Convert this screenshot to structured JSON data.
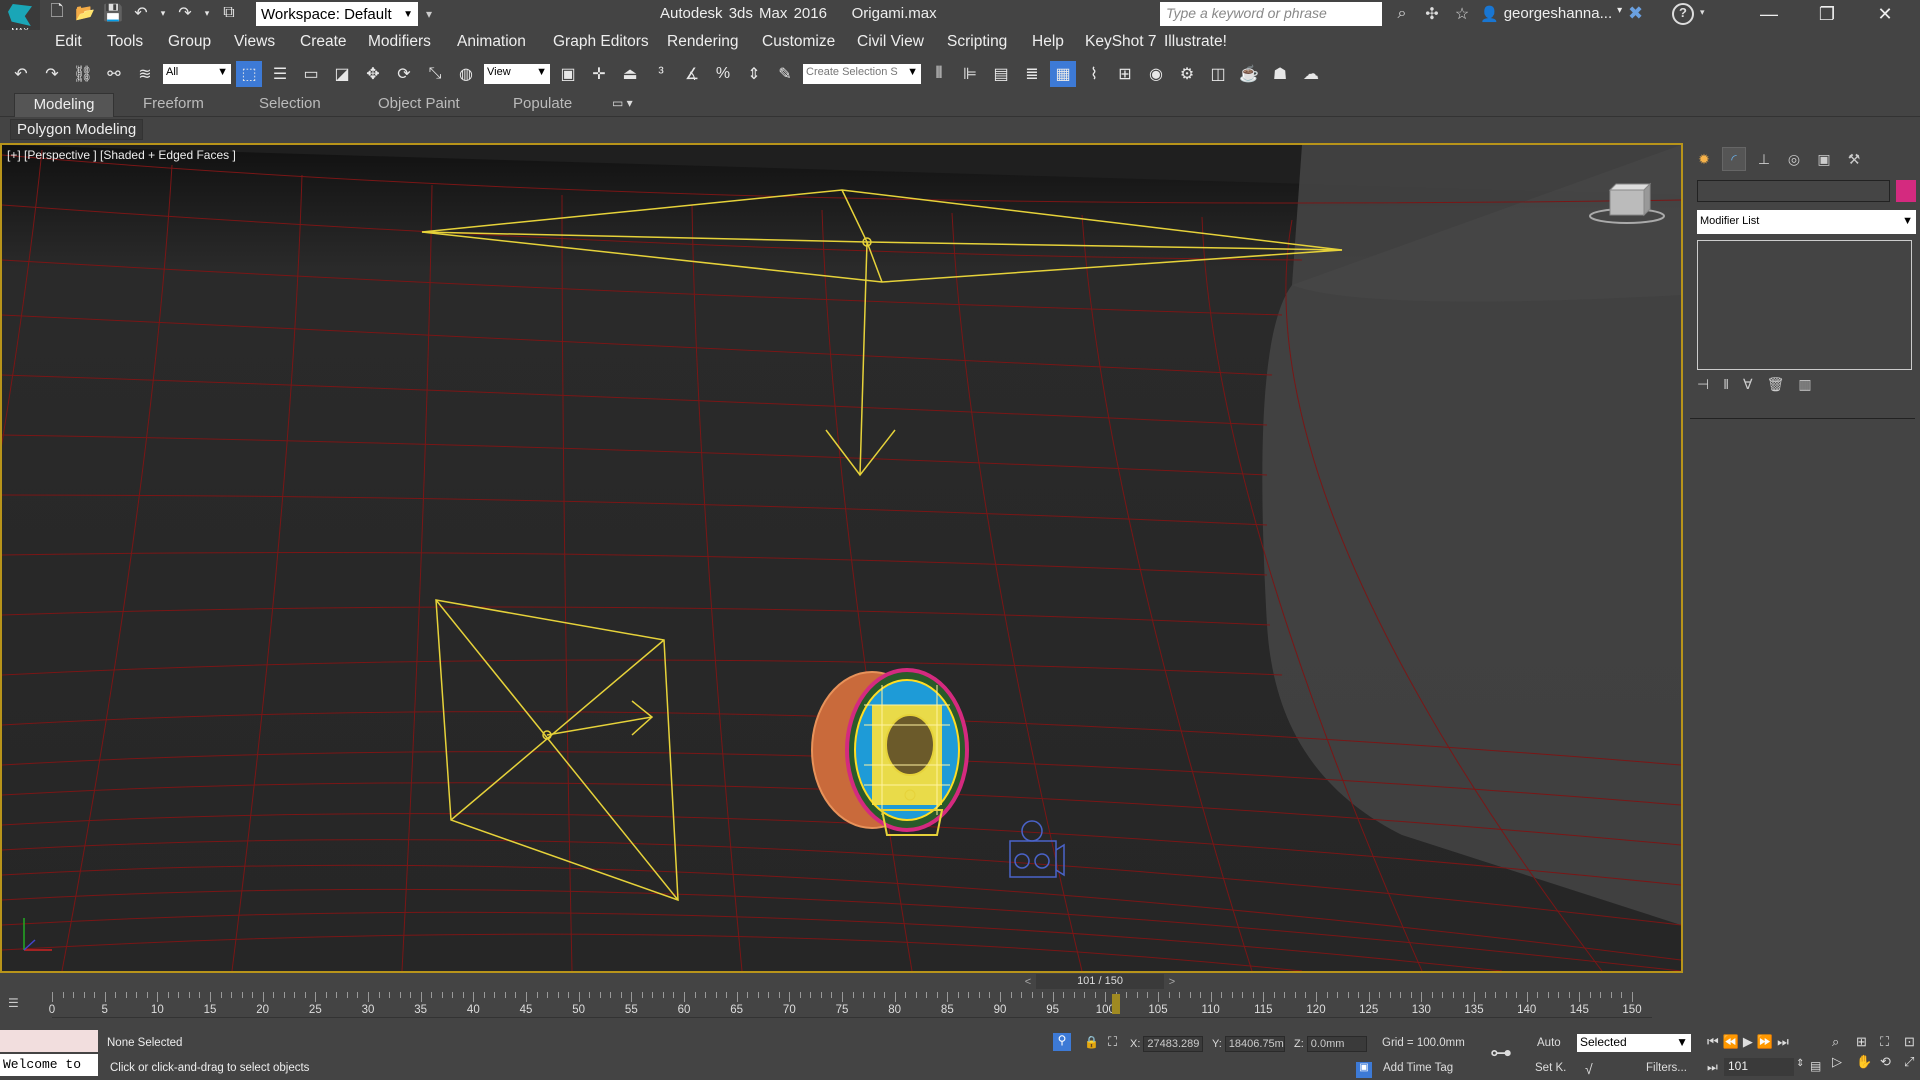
{
  "app": {
    "logo_text": "MAX",
    "title": "Autodesk 3ds Max 2016    Origami.max",
    "workspace": "Workspace: Default",
    "search_placeholder": "Type a keyword or phrase",
    "user": "georgeshanna...",
    "window_controls": [
      "—",
      "❐",
      "✕"
    ]
  },
  "menu": [
    "Edit",
    "Tools",
    "Group",
    "Views",
    "Create",
    "Modifiers",
    "Animation",
    "Graph Editors",
    "Rendering",
    "Customize",
    "Civil View",
    "Scripting",
    "Help",
    "KeyShot 7",
    "Illustrate!"
  ],
  "toolbar": {
    "filter": "All",
    "ref_coord": "View",
    "selection_set": "Create Selection S"
  },
  "ribbon": {
    "tabs": [
      "Modeling",
      "Freeform",
      "Selection",
      "Object Paint",
      "Populate"
    ],
    "active_tab": "Modeling",
    "sub": "Polygon Modeling"
  },
  "viewport": {
    "label": "[+] [Perspective ] [Shaded + Edged Faces ]"
  },
  "command_panel": {
    "modifier_list": "Modifier List",
    "object_color": "#d42a7f"
  },
  "timeline": {
    "frame_display": "101 / 150",
    "ticks": [
      "0",
      "5",
      "10",
      "15",
      "20",
      "25",
      "30",
      "35",
      "40",
      "45",
      "50",
      "55",
      "60",
      "65",
      "70",
      "75",
      "80",
      "85",
      "90",
      "95",
      "100",
      "105",
      "110",
      "115",
      "120",
      "125",
      "130",
      "135",
      "140",
      "145",
      "150"
    ],
    "current_frame": 101,
    "total_frames": 150
  },
  "status": {
    "maxscript_output": "Welcome to",
    "selection": "None Selected",
    "prompt": "Click or click-and-drag to select objects",
    "x": "27483.289",
    "y": "18406.75m",
    "z": "0.0mm",
    "grid": "Grid = 100.0mm",
    "add_time_tag": "Add Time Tag",
    "auto": "Auto",
    "set_key": "Set K.",
    "key_mode": "Selected",
    "filters": "Filters...",
    "frame": "101",
    "x_label": "X:",
    "y_label": "Y:",
    "z_label": "Z:"
  }
}
